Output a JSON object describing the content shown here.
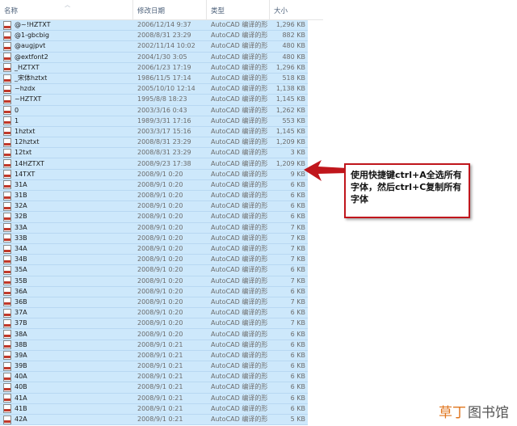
{
  "header": {
    "col_name": "名称",
    "col_date": "修改日期",
    "col_type": "类型",
    "col_size": "大小"
  },
  "files": [
    {
      "name": "@~!HZTXT",
      "date": "2006/12/14 9:37",
      "type": "AutoCAD 编译的形",
      "size": "1,296 KB"
    },
    {
      "name": "@1-gbcbig",
      "date": "2008/8/31 23:29",
      "type": "AutoCAD 编译的形",
      "size": "882 KB"
    },
    {
      "name": "@augjpvt",
      "date": "2002/11/14 10:02",
      "type": "AutoCAD 编译的形",
      "size": "480 KB"
    },
    {
      "name": "@extfont2",
      "date": "2004/1/30 3:05",
      "type": "AutoCAD 编译的形",
      "size": "480 KB"
    },
    {
      "name": "_HZTXT",
      "date": "2006/1/23 17:19",
      "type": "AutoCAD 编译的形",
      "size": "1,296 KB"
    },
    {
      "name": "_宋体hztxt",
      "date": "1986/11/5 17:14",
      "type": "AutoCAD 编译的形",
      "size": "518 KB"
    },
    {
      "name": "~hzdx",
      "date": "2005/10/10 12:14",
      "type": "AutoCAD 编译的形",
      "size": "1,138 KB"
    },
    {
      "name": "~HZTXT",
      "date": "1995/8/8 18:23",
      "type": "AutoCAD 编译的形",
      "size": "1,145 KB"
    },
    {
      "name": "0",
      "date": "2003/3/16 0:43",
      "type": "AutoCAD 编译的形",
      "size": "1,262 KB"
    },
    {
      "name": "1",
      "date": "1989/3/31 17:16",
      "type": "AutoCAD 编译的形",
      "size": "553 KB"
    },
    {
      "name": "1hztxt",
      "date": "2003/3/17 15:16",
      "type": "AutoCAD 编译的形",
      "size": "1,145 KB"
    },
    {
      "name": "12hztxt",
      "date": "2008/8/31 23:29",
      "type": "AutoCAD 编译的形",
      "size": "1,209 KB"
    },
    {
      "name": "12txt",
      "date": "2008/8/31 23:29",
      "type": "AutoCAD 编译的形",
      "size": "3 KB"
    },
    {
      "name": "14HZTXT",
      "date": "2008/9/23 17:38",
      "type": "AutoCAD 编译的形",
      "size": "1,209 KB"
    },
    {
      "name": "14TXT",
      "date": "2008/9/1 0:20",
      "type": "AutoCAD 编译的形",
      "size": "9 KB"
    },
    {
      "name": "31A",
      "date": "2008/9/1 0:20",
      "type": "AutoCAD 编译的形",
      "size": "6 KB"
    },
    {
      "name": "31B",
      "date": "2008/9/1 0:20",
      "type": "AutoCAD 编译的形",
      "size": "6 KB"
    },
    {
      "name": "32A",
      "date": "2008/9/1 0:20",
      "type": "AutoCAD 编译的形",
      "size": "6 KB"
    },
    {
      "name": "32B",
      "date": "2008/9/1 0:20",
      "type": "AutoCAD 编译的形",
      "size": "6 KB"
    },
    {
      "name": "33A",
      "date": "2008/9/1 0:20",
      "type": "AutoCAD 编译的形",
      "size": "7 KB"
    },
    {
      "name": "33B",
      "date": "2008/9/1 0:20",
      "type": "AutoCAD 编译的形",
      "size": "7 KB"
    },
    {
      "name": "34A",
      "date": "2008/9/1 0:20",
      "type": "AutoCAD 编译的形",
      "size": "7 KB"
    },
    {
      "name": "34B",
      "date": "2008/9/1 0:20",
      "type": "AutoCAD 编译的形",
      "size": "7 KB"
    },
    {
      "name": "35A",
      "date": "2008/9/1 0:20",
      "type": "AutoCAD 编译的形",
      "size": "6 KB"
    },
    {
      "name": "35B",
      "date": "2008/9/1 0:20",
      "type": "AutoCAD 编译的形",
      "size": "7 KB"
    },
    {
      "name": "36A",
      "date": "2008/9/1 0:20",
      "type": "AutoCAD 编译的形",
      "size": "6 KB"
    },
    {
      "name": "36B",
      "date": "2008/9/1 0:20",
      "type": "AutoCAD 编译的形",
      "size": "7 KB"
    },
    {
      "name": "37A",
      "date": "2008/9/1 0:20",
      "type": "AutoCAD 编译的形",
      "size": "6 KB"
    },
    {
      "name": "37B",
      "date": "2008/9/1 0:20",
      "type": "AutoCAD 编译的形",
      "size": "7 KB"
    },
    {
      "name": "38A",
      "date": "2008/9/1 0:20",
      "type": "AutoCAD 编译的形",
      "size": "6 KB"
    },
    {
      "name": "38B",
      "date": "2008/9/1 0:21",
      "type": "AutoCAD 编译的形",
      "size": "6 KB"
    },
    {
      "name": "39A",
      "date": "2008/9/1 0:21",
      "type": "AutoCAD 编译的形",
      "size": "6 KB"
    },
    {
      "name": "39B",
      "date": "2008/9/1 0:21",
      "type": "AutoCAD 编译的形",
      "size": "6 KB"
    },
    {
      "name": "40A",
      "date": "2008/9/1 0:21",
      "type": "AutoCAD 编译的形",
      "size": "6 KB"
    },
    {
      "name": "40B",
      "date": "2008/9/1 0:21",
      "type": "AutoCAD 编译的形",
      "size": "6 KB"
    },
    {
      "name": "41A",
      "date": "2008/9/1 0:21",
      "type": "AutoCAD 编译的形",
      "size": "6 KB"
    },
    {
      "name": "41B",
      "date": "2008/9/1 0:21",
      "type": "AutoCAD 编译的形",
      "size": "6 KB"
    },
    {
      "name": "42A",
      "date": "2008/9/1 0:21",
      "type": "AutoCAD 编译的形",
      "size": "5 KB"
    }
  ],
  "callout": {
    "text": "使用快捷键ctrl+A全选所有字体，然后ctrl+C复制所有字体"
  },
  "watermark": {
    "part1": "草丁",
    "part2": "图书馆"
  },
  "colors": {
    "selection": "#cde8fb",
    "callout_border": "#c0161c",
    "watermark_accent": "#e0761f"
  },
  "icons": {
    "file": "shx-file-icon",
    "sort": "sort-up-icon"
  }
}
